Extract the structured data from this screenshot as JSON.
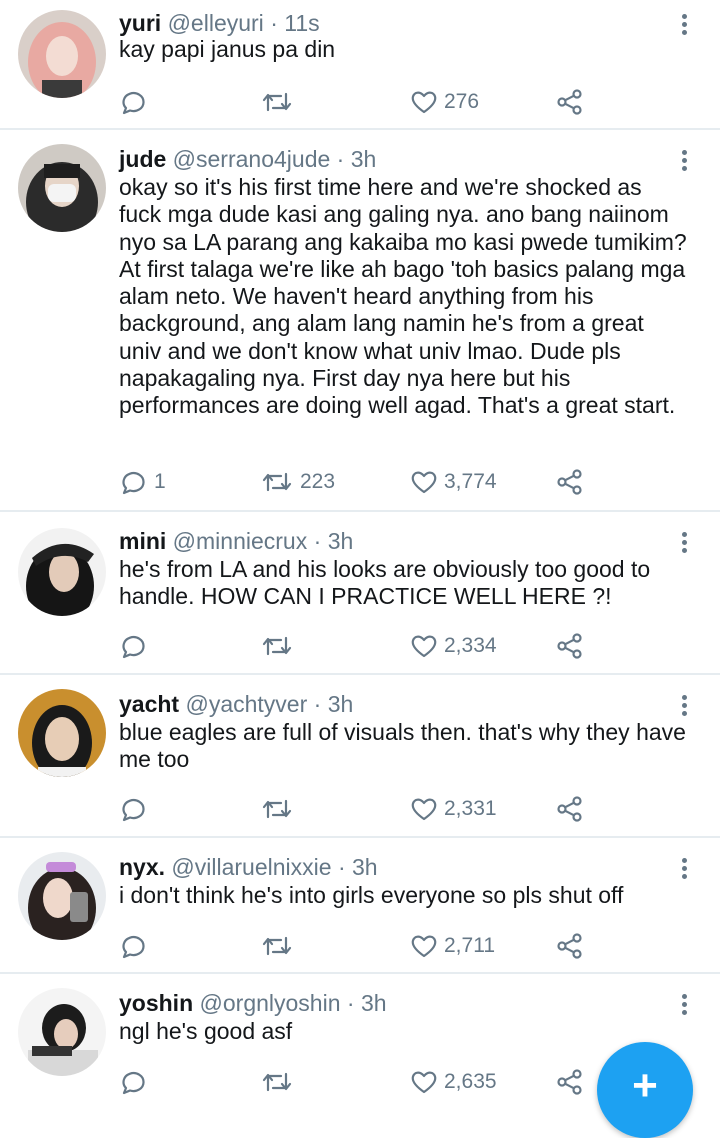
{
  "colors": {
    "accent": "#1da1f2",
    "text": "#14171a",
    "secondary": "#657786",
    "divider": "#e6ecf0"
  },
  "icons": {
    "reply": "reply-icon",
    "retweet": "retweet-icon",
    "like": "heart-icon",
    "share": "share-icon",
    "more": "more-vertical-icon",
    "compose": "plus-icon"
  },
  "tweets": [
    {
      "name": "yuri",
      "handle": "@elleyuri",
      "sep": "·",
      "time": "11s",
      "text": "kay papi janus pa din",
      "replies": "",
      "retweets": "",
      "likes": "276"
    },
    {
      "name": "jude",
      "handle": "@serrano4jude",
      "sep": "·",
      "time": "3h",
      "text": "okay so it's his first time here and we're shocked as fuck mga dude kasi ang galing nya. ano bang naiinom nyo sa LA parang ang kakaiba mo kasi pwede tumikim? At first talaga we're like ah bago 'toh basics palang mga alam neto. We haven't heard anything from his background, ang alam lang namin he's from a great univ and we don't know what univ lmao. Dude pls napakagaling nya. First day nya here but his performances are doing well agad. That's a great start.",
      "replies": "1",
      "retweets": "223",
      "likes": "3,774"
    },
    {
      "name": "mini",
      "handle": "@minniecrux",
      "sep": "·",
      "time": "3h",
      "text": "he's from LA and his looks are obviously too good to handle. HOW CAN I PRACTICE WELL HERE ?!",
      "replies": "",
      "retweets": "",
      "likes": "2,334"
    },
    {
      "name": "yacht",
      "handle": "@yachtyver",
      "sep": "·",
      "time": "3h",
      "text": "blue eagles are full of visuals then. that's why they have me too",
      "replies": "",
      "retweets": "",
      "likes": "2,331"
    },
    {
      "name": "nyx.",
      "handle": "@villaruelnixxie",
      "sep": "·",
      "time": "3h",
      "text": "i don't think he's into girls everyone so pls shut off",
      "replies": "",
      "retweets": "",
      "likes": "2,711"
    },
    {
      "name": "yoshin",
      "handle": "@orgnlyoshin",
      "sep": "·",
      "time": "3h",
      "text": "ngl he's good asf",
      "replies": "",
      "retweets": "",
      "likes": "2,635"
    }
  ],
  "compose": {
    "label": "+"
  }
}
